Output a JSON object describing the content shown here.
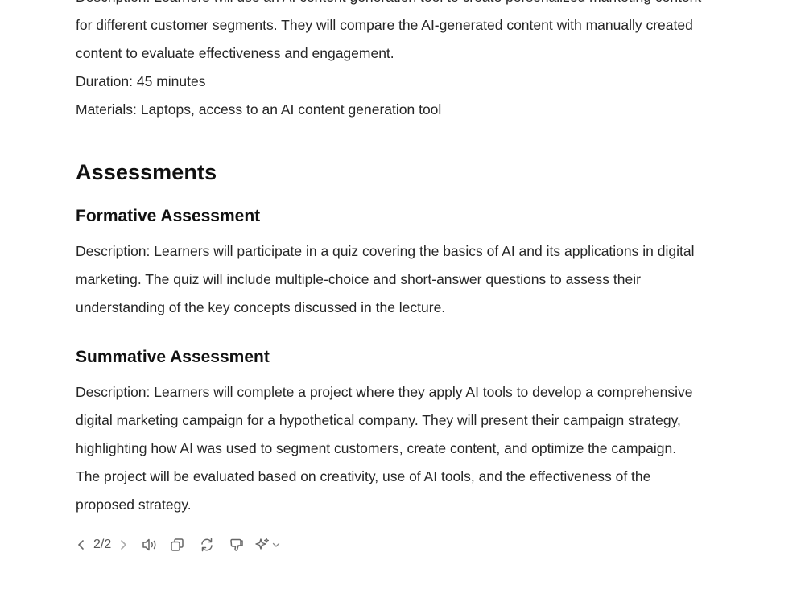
{
  "activity": {
    "description_lines": [
      "Description: Learners will use an AI content generation tool to create personalized marketing content",
      "for different customer segments. They will compare the AI-generated content with manually created",
      "content to evaluate effectiveness and engagement."
    ],
    "duration": "Duration: 45 minutes",
    "materials": "Materials: Laptops, access to an AI content generation tool"
  },
  "assessments": {
    "heading": "Assessments",
    "formative": {
      "heading": "Formative Assessment",
      "lines": [
        "Description: Learners will participate in a quiz covering the basics of AI and its applications in digital",
        "marketing. The quiz will include multiple-choice and short-answer questions to assess their",
        "understanding of the key concepts discussed in the lecture."
      ]
    },
    "summative": {
      "heading": "Summative Assessment",
      "lines": [
        "Description: Learners will complete a project where they apply AI tools to develop a comprehensive",
        "digital marketing campaign for a hypothetical company. They will present their campaign strategy,",
        "highlighting how AI was used to segment customers, create content, and optimize the campaign.",
        "The project will be evaluated based on creativity, use of AI tools, and the effectiveness of the",
        "proposed strategy."
      ]
    }
  },
  "toolbar": {
    "page_indicator": "2/2",
    "icons": [
      "chevron-left-icon",
      "chevron-right-icon",
      "read-aloud-icon",
      "copy-icon",
      "regenerate-icon",
      "thumbs-down-icon",
      "sparkle-icon",
      "chevron-down-icon"
    ]
  }
}
